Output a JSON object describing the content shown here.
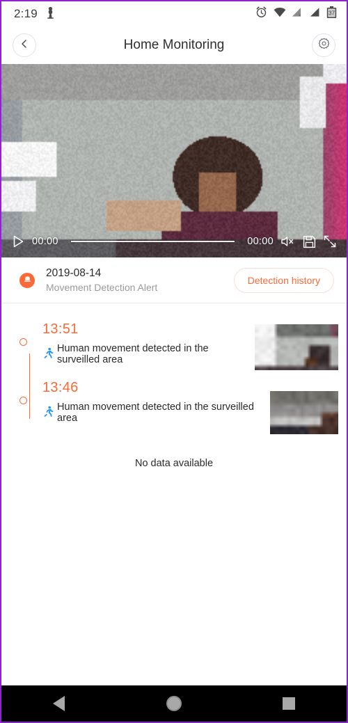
{
  "statusbar": {
    "time": "2:19",
    "notification_icon": "chess-pawn-icon",
    "alarm_icon": "alarm-clock-icon",
    "wifi_icon": "wifi-icon",
    "signal_no_sim_icon": "signal-no-service-icon",
    "signal_icon": "signal-full-icon",
    "battery_level": "37"
  },
  "appbar": {
    "back_icon": "chevron-left-icon",
    "title": "Home Monitoring",
    "settings_icon": "gear-icon"
  },
  "video": {
    "play_icon": "play-icon",
    "current_time": "00:00",
    "duration": "00:00",
    "mute_icon": "volume-muted-icon",
    "save_icon": "save-floppy-icon",
    "fullscreen_icon": "fullscreen-expand-icon",
    "progress_percent": 0
  },
  "alert": {
    "badge_icon": "alert-bell-icon",
    "date": "2019-08-14",
    "subtitle": "Movement Detection Alert",
    "history_button": "Detection history",
    "accent_color": "#fb6a36"
  },
  "timeline": {
    "events": [
      {
        "time": "13:51",
        "icon": "running-person-icon",
        "description": "Human movement detected in the surveilled area",
        "thumbnail": "motion-snapshot-thumbnail"
      },
      {
        "time": "13:46",
        "icon": "running-person-icon",
        "description": "Human movement detected in the surveilled area",
        "thumbnail": "motion-snapshot-thumbnail"
      }
    ],
    "empty_message": "No data available"
  },
  "navbar": {
    "back_icon": "nav-back-triangle-icon",
    "home_icon": "nav-home-circle-icon",
    "recents_icon": "nav-recents-square-icon"
  },
  "colors": {
    "accent": "#fb6a36",
    "device_border": "#8e24cf",
    "text_primary": "#2b2b2e",
    "text_muted": "#9b9b9f",
    "run_icon": "#2196f3"
  }
}
